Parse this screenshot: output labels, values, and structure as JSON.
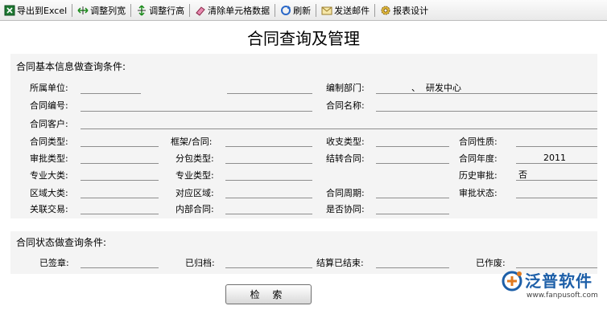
{
  "toolbar": {
    "items": [
      {
        "label": "导出到Excel",
        "icon": "excel-icon"
      },
      {
        "label": "调整列宽",
        "icon": "column-width-icon"
      },
      {
        "label": "调整行高",
        "icon": "row-height-icon"
      },
      {
        "label": "清除单元格数据",
        "icon": "eraser-icon"
      },
      {
        "label": "刷新",
        "icon": "refresh-icon"
      },
      {
        "label": "发送邮件",
        "icon": "mail-icon"
      },
      {
        "label": "报表设计",
        "icon": "gear-icon"
      }
    ]
  },
  "page_title": "合同查询及管理",
  "basic_section": {
    "title": "合同基本信息做查询条件:",
    "labels": {
      "dept": "所属单位:",
      "compile_dept": "编制部门:",
      "contract_no": "合同编号:",
      "contract_name": "合同名称:",
      "customer": "合同客户:",
      "contract_type": "合同类型:",
      "framework": "框架/合同:",
      "income_type": "收支类型:",
      "nature": "合同性质:",
      "approval_type": "审批类型:",
      "sub_type": "分包类型:",
      "transfer": "结转合同:",
      "year": "合同年度:",
      "major_class": "专业大类:",
      "major_type": "专业类型:",
      "history": "历史审批:",
      "region_class": "区域大类:",
      "region": "对应区域:",
      "period": "合同周期:",
      "approval_status": "审批状态:",
      "related": "关联交易:",
      "internal": "内部合同:",
      "cooperative": "是否协同:"
    },
    "values": {
      "compile_dept_mark": "、",
      "compile_dept_name": "研发中心",
      "year": "2011",
      "history": "否"
    }
  },
  "status_section": {
    "title": "合同状态做查询条件:",
    "labels": {
      "signed": "已签章:",
      "archived": "已归档:",
      "settled": "结算已结束:",
      "voided": "已作废:"
    }
  },
  "search_button": "检 索",
  "logo": {
    "name": "泛普软件",
    "url": "www.fanpusoft.com",
    "color": "#1d5fa8"
  }
}
